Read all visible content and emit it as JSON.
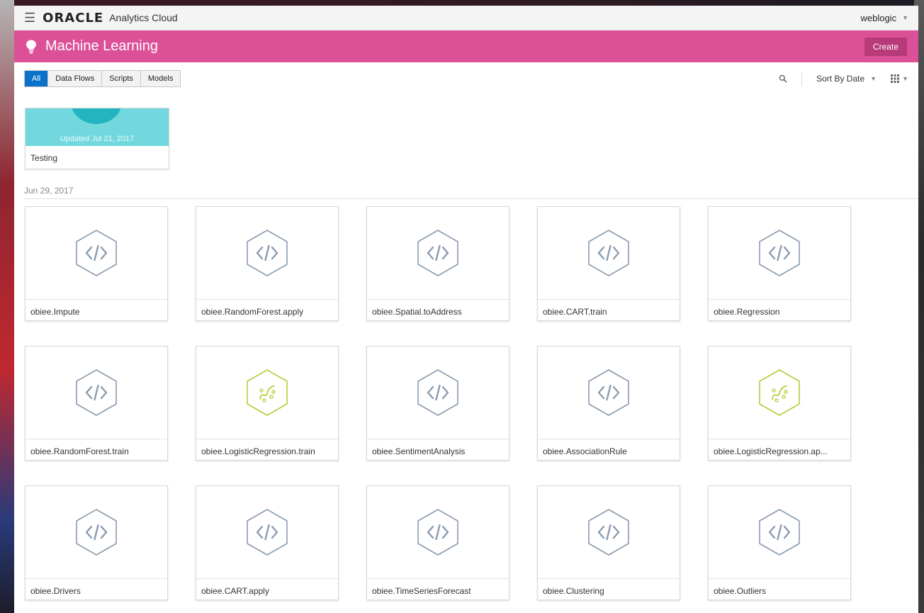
{
  "topbar": {
    "brand": "ORACLE",
    "product": "Analytics Cloud",
    "user": "weblogic"
  },
  "banner": {
    "title": "Machine Learning",
    "create_label": "Create",
    "color": "#dc5098"
  },
  "filters": {
    "tabs": [
      "All",
      "Data Flows",
      "Scripts",
      "Models"
    ],
    "active": "All"
  },
  "sort": {
    "label": "Sort By Date"
  },
  "recent": {
    "title": "Testing",
    "updated": "Updated Jul 21, 2017"
  },
  "section": {
    "date": "Jun 29, 2017"
  },
  "items": [
    {
      "label": "obiee.Impute",
      "icon": "script-code-icon"
    },
    {
      "label": "obiee.RandomForest.apply",
      "icon": "script-code-icon"
    },
    {
      "label": "obiee.Spatial.toAddress",
      "icon": "script-code-icon"
    },
    {
      "label": "obiee.CART.train",
      "icon": "script-code-icon"
    },
    {
      "label": "obiee.Regression",
      "icon": "script-code-icon"
    },
    {
      "label": "obiee.RandomForest.train",
      "icon": "script-code-icon"
    },
    {
      "label": "obiee.LogisticRegression.train",
      "icon": "model-icon"
    },
    {
      "label": "obiee.SentimentAnalysis",
      "icon": "script-code-icon"
    },
    {
      "label": "obiee.AssociationRule",
      "icon": "script-code-icon"
    },
    {
      "label": "obiee.LogisticRegression.ap...",
      "icon": "model-icon"
    },
    {
      "label": "obiee.Drivers",
      "icon": "script-code-icon"
    },
    {
      "label": "obiee.CART.apply",
      "icon": "script-code-icon"
    },
    {
      "label": "obiee.TimeSeriesForecast",
      "icon": "script-code-icon"
    },
    {
      "label": "obiee.Clustering",
      "icon": "script-code-icon"
    },
    {
      "label": "obiee.Outliers",
      "icon": "script-code-icon"
    }
  ],
  "colors": {
    "accent_tab": "#0b72c9",
    "script_icon": "#8a9bb0",
    "model_icon": "#b8cc3a"
  }
}
